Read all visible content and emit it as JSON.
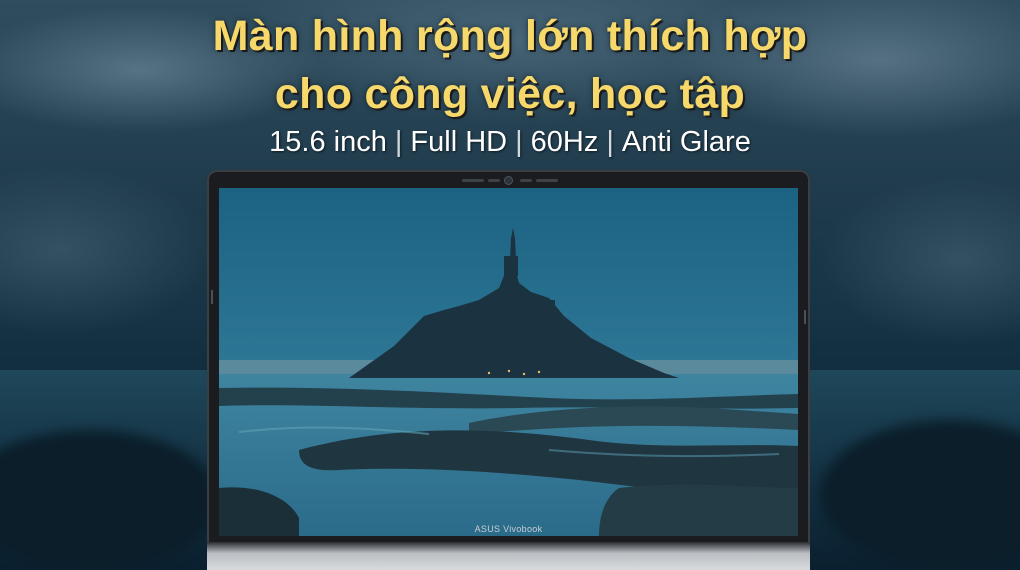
{
  "headline": {
    "line1": "Màn hình rộng lớn thích hợp",
    "line2": "cho công việc, học tập"
  },
  "specs": {
    "size": "15.6 inch",
    "resolution": "Full HD",
    "refresh": "60Hz",
    "coating": "Anti Glare",
    "separator": "|"
  },
  "laptop": {
    "brand_label": "ASUS Vivobook"
  },
  "colors": {
    "headline": "#f6d86b",
    "specs_text": "#ffffff",
    "bezel": "#1a1c1f"
  }
}
